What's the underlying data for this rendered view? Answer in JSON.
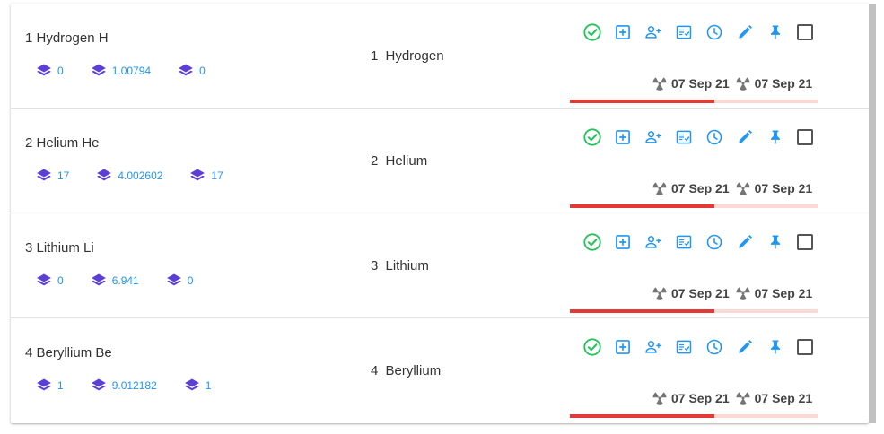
{
  "colors": {
    "accent": "#2196f3",
    "stat_icon": "#5c3fd6",
    "check_icon": "#21c45a",
    "progress_fill": "#e53935",
    "progress_track": "#fcd9d5",
    "radiation_icon": "#757575"
  },
  "row_actions": [
    {
      "name": "approve-icon",
      "icon": "check-circle"
    },
    {
      "name": "add-box-icon",
      "icon": "plus-square"
    },
    {
      "name": "add-user-icon",
      "icon": "person-plus"
    },
    {
      "name": "checklist-icon",
      "icon": "list-check"
    },
    {
      "name": "clock-icon",
      "icon": "schedule"
    },
    {
      "name": "edit-icon",
      "icon": "pencil"
    },
    {
      "name": "pin-icon",
      "icon": "push-pin"
    }
  ],
  "rows": [
    {
      "title": "1 Hydrogen H",
      "name": "1 Hydrogen",
      "stats": [
        "0",
        "1.00794",
        "0"
      ],
      "dates": [
        "07 Sep 21",
        "07 Sep 21"
      ],
      "progress": 0.58
    },
    {
      "title": "2 Helium He",
      "name": "2 Helium",
      "stats": [
        "17",
        "4.002602",
        "17"
      ],
      "dates": [
        "07 Sep 21",
        "07 Sep 21"
      ],
      "progress": 0.58
    },
    {
      "title": "3 Lithium Li",
      "name": "3 Lithium",
      "stats": [
        "0",
        "6.941",
        "0"
      ],
      "dates": [
        "07 Sep 21",
        "07 Sep 21"
      ],
      "progress": 0.58
    },
    {
      "title": "4 Beryllium Be",
      "name": "4 Beryllium",
      "stats": [
        "1",
        "9.012182",
        "1"
      ],
      "dates": [
        "07 Sep 21",
        "07 Sep 21"
      ],
      "progress": 0.58
    }
  ]
}
